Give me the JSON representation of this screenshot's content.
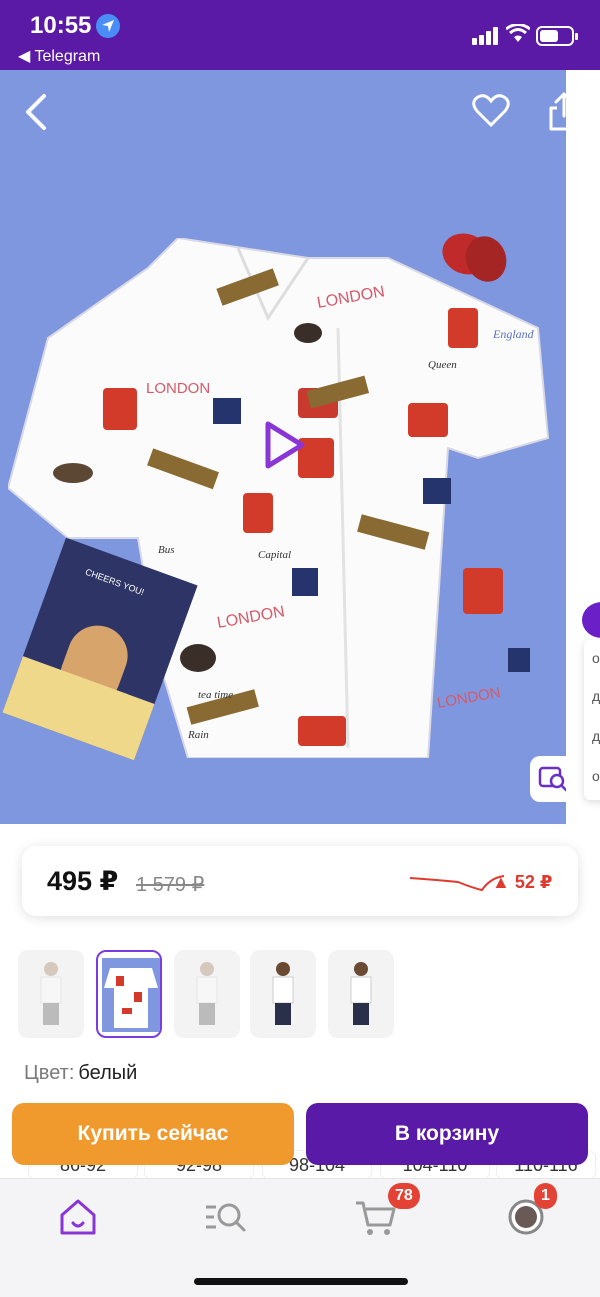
{
  "status_bar": {
    "time": "10:55",
    "back_app": "◀ Telegram"
  },
  "price": {
    "current": "495 ₽",
    "old": "1 579 ₽",
    "delta": "▲ 52 ₽"
  },
  "color": {
    "label": "Цвет:",
    "value": "белый"
  },
  "sizes": [
    "86-92",
    "92-98",
    "98-104",
    "104-110",
    "110-116"
  ],
  "buttons": {
    "buy_now": "Купить сейчас",
    "add_to_cart": "В корзину"
  },
  "nav": {
    "cart_badge": "78",
    "profile_badge": "1"
  },
  "side_panel": [
    "о",
    "д",
    "д",
    "о"
  ],
  "card_text": "CHEERS YOU!",
  "shirt_labels": [
    "LONDON",
    "LONDON",
    "LONDON",
    "LONDON",
    "England",
    "Queen",
    "Capital",
    "tea time",
    "Bus",
    "Rain"
  ],
  "colors": {
    "brand_purple": "#5b1aa6",
    "accent_orange": "#f09a2e",
    "hero_bg": "#7f97df",
    "badge_red": "#e34234",
    "price_up_red": "#e03a2f"
  }
}
